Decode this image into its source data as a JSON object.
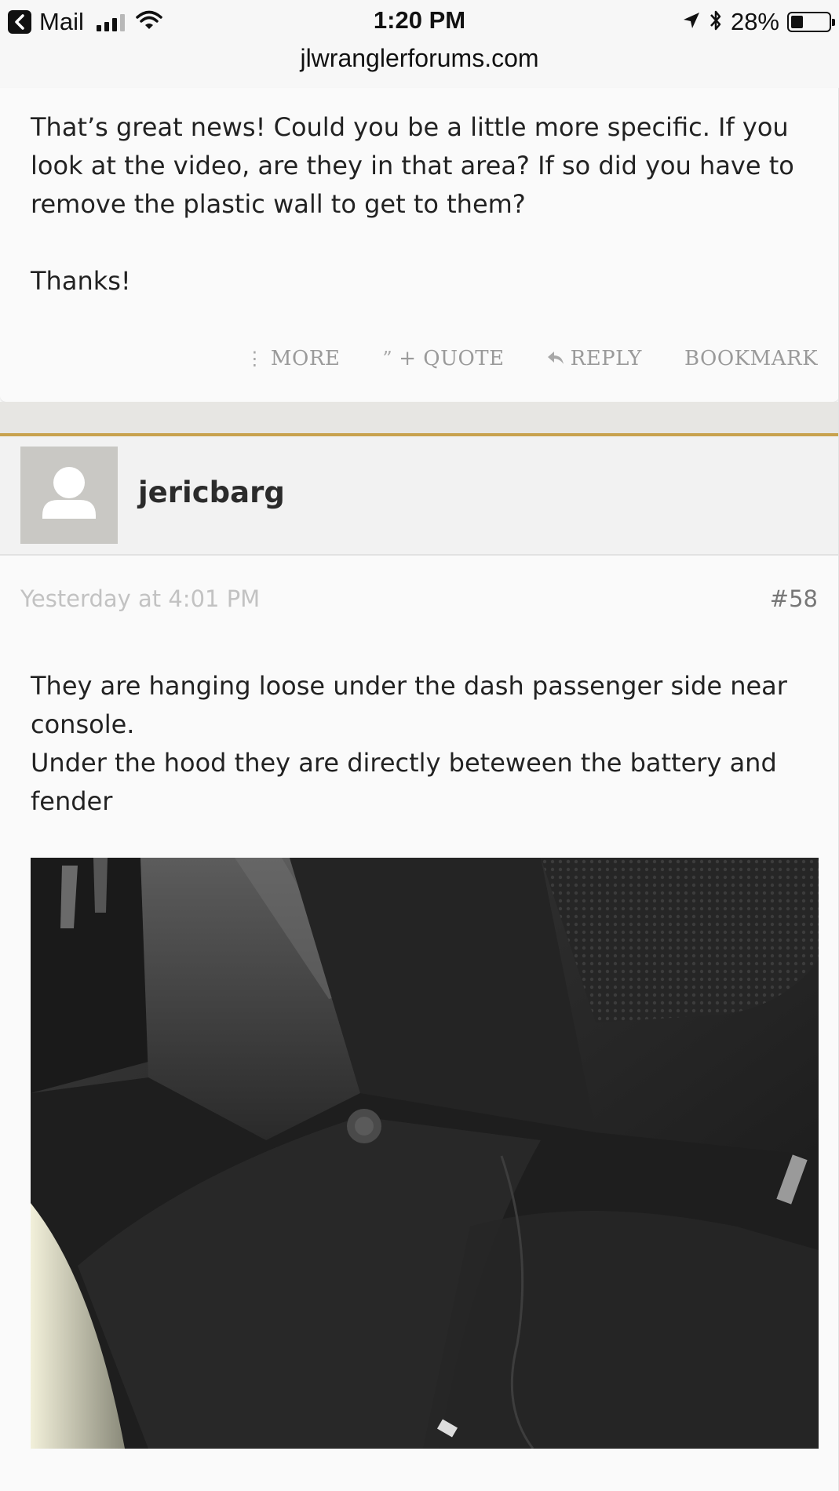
{
  "status_bar": {
    "back_app": "Mail",
    "time": "1:20 PM",
    "battery_pct": "28%",
    "battery_level": 0.28,
    "url": "jlwranglerforums.com",
    "icons": [
      "back-icon",
      "signal-icon",
      "wifi-icon",
      "location-icon",
      "bluetooth-icon",
      "battery-icon"
    ]
  },
  "prev_post": {
    "paragraphs": [
      "That’s great news! Could you be a little more specific. If you look at the video, are they in that area? If so did you have to remove the plastic wall to get to them?",
      "Thanks!"
    ],
    "actions": {
      "more": "MORE",
      "quote": "+ QUOTE",
      "reply": "REPLY",
      "bookmark": "BOOKMARK"
    }
  },
  "post": {
    "username": "jericbarg",
    "timestamp": "Yesterday at 4:01 PM",
    "post_number": "#58",
    "lines": [
      "They are hanging loose under the dash passenger side near console.",
      "Under the hood they are directly beteween the battery and fender"
    ],
    "attachment_icon": "car-floor-photo"
  },
  "colors": {
    "accent": "#c8a24e",
    "muted": "#9a9a9a",
    "timestamp": "#c2c2c2"
  }
}
